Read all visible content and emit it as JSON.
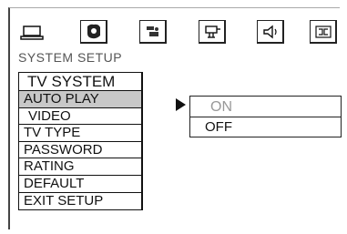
{
  "toolbar": {
    "icons": [
      {
        "name": "monitor-icon"
      },
      {
        "name": "system-settings-icon"
      },
      {
        "name": "language-icon"
      },
      {
        "name": "video-icon"
      },
      {
        "name": "speaker-icon"
      },
      {
        "name": "dolby-icon"
      }
    ]
  },
  "page": {
    "section_title": "SYSTEM  SETUP"
  },
  "menu": {
    "header": "TV SYSTEM",
    "items": [
      "AUTO PLAY",
      "VIDEO",
      "TV TYPE",
      "PASSWORD",
      "RATING",
      "DEFAULT",
      "EXIT SETUP"
    ],
    "selected_index": 0
  },
  "submenu": {
    "options": [
      "ON",
      "OFF"
    ],
    "highlighted": "ON"
  }
}
